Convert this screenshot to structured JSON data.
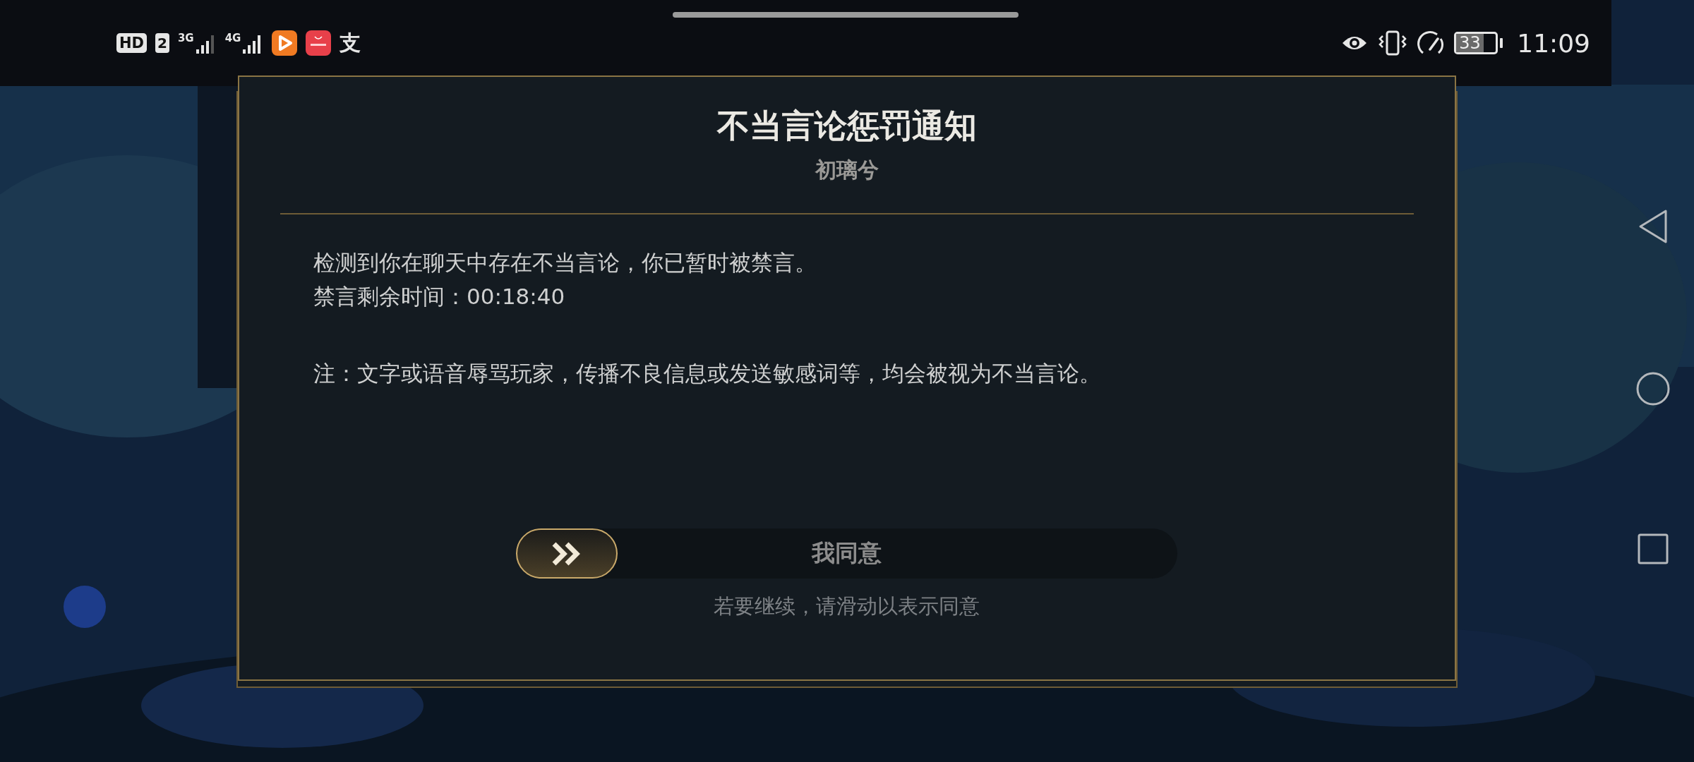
{
  "status_bar": {
    "left": [
      {
        "kind": "hd",
        "text": "HD"
      },
      {
        "kind": "sim",
        "text": "2"
      },
      {
        "kind": "signal",
        "text": "3G"
      },
      {
        "kind": "signal-full",
        "text": "4G"
      },
      {
        "kind": "video-app"
      },
      {
        "kind": "store-app"
      },
      {
        "kind": "glyph",
        "text": "支"
      }
    ],
    "right": [
      {
        "kind": "eye"
      },
      {
        "kind": "vibrate"
      },
      {
        "kind": "gauge"
      }
    ],
    "battery": "33",
    "time": "11:09"
  },
  "dialog": {
    "title": "不当言论惩罚通知",
    "subtitle": "初璃兮",
    "paragraphs": [
      "检测到你在聊天中存在不当言论，你已暂时被禁言。",
      "禁言剩余时间：00:18:40"
    ],
    "note": "注：文字或语音辱骂玩家，传播不良信息或发送敏感词等，均会被视为不当言论。",
    "slider": {
      "label": "我同意",
      "level": 0,
      "hint": "若要继续，请滑动以表示同意"
    }
  },
  "nav_bar": [
    {
      "kind": "back"
    },
    {
      "kind": "home"
    },
    {
      "kind": "recents"
    }
  ]
}
